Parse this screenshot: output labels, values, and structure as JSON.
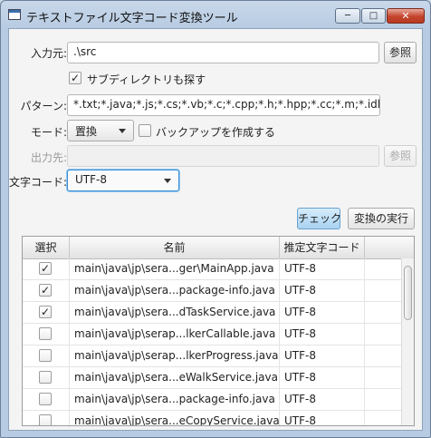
{
  "window": {
    "title": "テキストファイル文字コード変換ツール",
    "min_glyph": "─",
    "max_glyph": "□",
    "close_glyph": "✕"
  },
  "form": {
    "input_label": "入力元:",
    "input_value": ".\\src",
    "browse_label": "参照",
    "subdir_label": "サブディレクトリも探す",
    "subdir_checked": true,
    "pattern_label": "パターン:",
    "pattern_value": "*.txt;*.java;*.js;*.cs;*.vb;*.c;*.cpp;*.h;*.hpp;*.cc;*.m;*.idl;",
    "mode_label": "モード:",
    "mode_value": "置換",
    "backup_label": "バックアップを作成する",
    "backup_checked": false,
    "output_label": "出力先:",
    "output_value": "",
    "output_browse_label": "参照",
    "charset_label": "文字コード:",
    "charset_value": "UTF-8"
  },
  "actions": {
    "check_label": "チェック",
    "convert_label": "変換の実行"
  },
  "table": {
    "columns": [
      "選択",
      "名前",
      "推定文字コード"
    ],
    "rows": [
      {
        "selected": true,
        "name": "main\\java\\jp\\sera...ger\\MainApp.java",
        "charset": "UTF-8"
      },
      {
        "selected": true,
        "name": "main\\java\\jp\\sera...package-info.java",
        "charset": "UTF-8"
      },
      {
        "selected": true,
        "name": "main\\java\\jp\\sera...dTaskService.java",
        "charset": "UTF-8"
      },
      {
        "selected": false,
        "name": "main\\java\\jp\\serap...lkerCallable.java",
        "charset": "UTF-8"
      },
      {
        "selected": false,
        "name": "main\\java\\jp\\serap...lkerProgress.java",
        "charset": "UTF-8"
      },
      {
        "selected": false,
        "name": "main\\java\\jp\\sera...eWalkService.java",
        "charset": "UTF-8"
      },
      {
        "selected": false,
        "name": "main\\java\\jp\\sera...package-info.java",
        "charset": "UTF-8"
      },
      {
        "selected": false,
        "name": "main\\java\\jp\\sera...eCopyService.java",
        "charset": "UTF-8"
      }
    ]
  }
}
